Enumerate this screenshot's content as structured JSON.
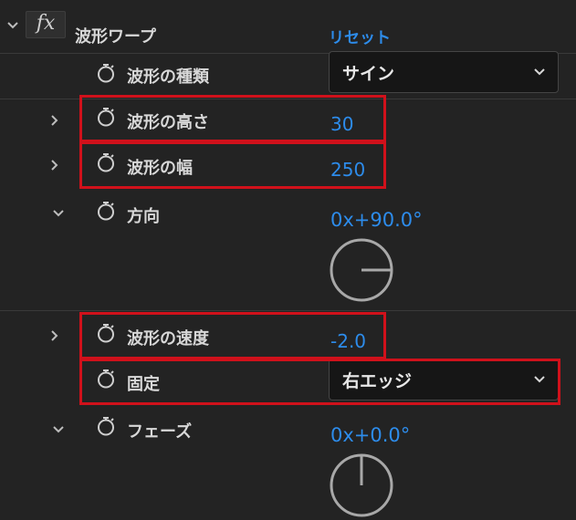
{
  "effect": {
    "fx_label": "fx",
    "name": "波形ワープ",
    "reset_label": "リセット"
  },
  "params": {
    "wave_type": {
      "label": "波形の種類",
      "value": "サイン"
    },
    "wave_height": {
      "label": "波形の高さ",
      "value": "30"
    },
    "wave_width": {
      "label": "波形の幅",
      "value": "250"
    },
    "direction": {
      "label": "方向",
      "value": "0x+90.0°",
      "angle_deg": 90
    },
    "wave_speed": {
      "label": "波形の速度",
      "value": "-2.0"
    },
    "pinning": {
      "label": "固定",
      "value": "右エッジ"
    },
    "phase": {
      "label": "フェーズ",
      "value": "0x+0.0°",
      "angle_deg": 0
    }
  },
  "colors": {
    "background": "#232323",
    "accent_value": "#2d8ceb",
    "highlight": "#d0111b"
  },
  "icons": {
    "twisty_open": "chevron-down-icon",
    "twisty_closed": "chevron-right-icon",
    "stopwatch": "stopwatch-icon",
    "dropdown": "chevron-down-icon"
  }
}
